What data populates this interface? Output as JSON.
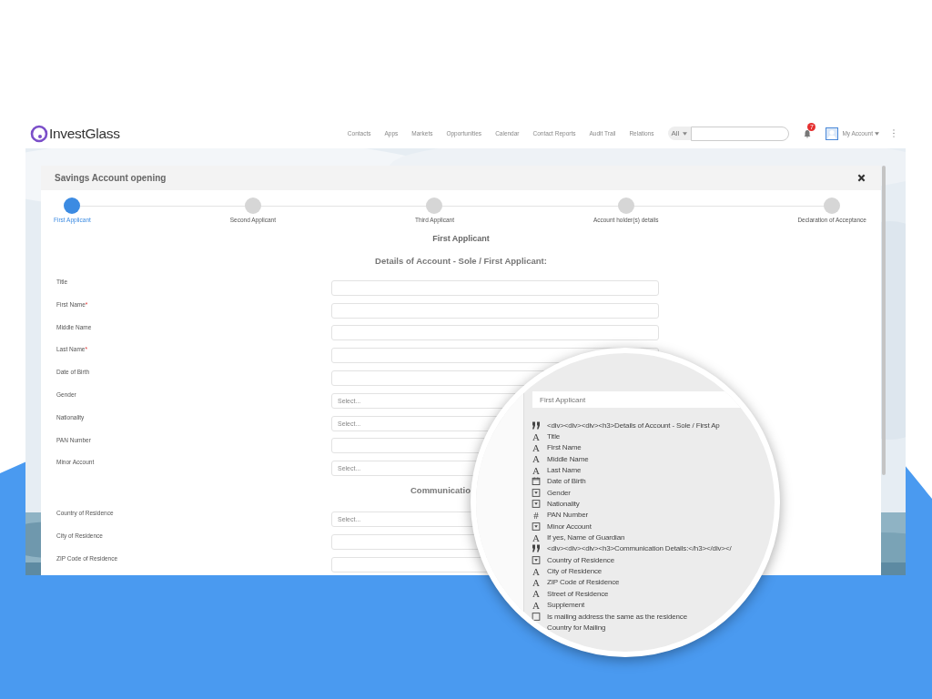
{
  "brand": {
    "name": "InvestGlass"
  },
  "nav": {
    "links": [
      "Contacts",
      "Apps",
      "Markets",
      "Opportunities",
      "Calendar",
      "Contact Reports",
      "Audit Trail",
      "Relations"
    ],
    "scope": "All",
    "notifications": "7",
    "account": "My Account"
  },
  "modal": {
    "title": "Savings Account opening",
    "steps": [
      {
        "label": "First Applicant",
        "selected": true
      },
      {
        "label": "Second Applicant",
        "selected": false
      },
      {
        "label": "Third Applicant",
        "selected": false
      },
      {
        "label": "Account holder(s) details",
        "selected": false
      },
      {
        "label": "Declaration of Acceptance",
        "selected": false
      }
    ],
    "heading": "First Applicant",
    "subheading": "Details of Account - Sole / First Applicant:",
    "rows": [
      {
        "label": "Title",
        "kind": "text"
      },
      {
        "label": "First Name",
        "required_mark": "*",
        "kind": "text"
      },
      {
        "label": "Middle Name",
        "kind": "text"
      },
      {
        "label": "Last Name",
        "required_mark": "*",
        "kind": "text"
      },
      {
        "label": "Date of Birth",
        "kind": "text"
      },
      {
        "label": "Gender",
        "kind": "select",
        "placeholder": "Select..."
      },
      {
        "label": "Nationality",
        "kind": "select",
        "placeholder": "Select..."
      },
      {
        "label": "PAN Number",
        "kind": "text"
      },
      {
        "label": "Minor Account",
        "kind": "select",
        "placeholder": "Select..."
      }
    ],
    "section": "Communicatio",
    "rows2": [
      {
        "label": "Country of Residence",
        "kind": "select",
        "placeholder": "Select..."
      },
      {
        "label": "City of Residence",
        "kind": "text"
      },
      {
        "label": "ZIP Code of Residence",
        "kind": "text"
      }
    ]
  },
  "magnifier": {
    "field": "First Applicant",
    "items": [
      {
        "kind": "html",
        "label": "<div><div><div><h3>Details of Account - Sole / First Ap"
      },
      {
        "kind": "text",
        "glyph": "A",
        "label": "Title"
      },
      {
        "kind": "text",
        "glyph": "A",
        "label": "First Name"
      },
      {
        "kind": "text",
        "glyph": "A",
        "label": "Middle Name"
      },
      {
        "kind": "text",
        "glyph": "A",
        "label": "Last Name"
      },
      {
        "kind": "date",
        "label": "Date of Birth"
      },
      {
        "kind": "select",
        "label": "Gender"
      },
      {
        "kind": "select",
        "label": "Nationality"
      },
      {
        "kind": "text",
        "glyph": "#",
        "label": "PAN Number"
      },
      {
        "kind": "select",
        "label": "Minor Account"
      },
      {
        "kind": "text",
        "glyph": "A",
        "label": "If yes, Name of Guardian"
      },
      {
        "kind": "html",
        "label": "<div><div><div><h3>Communication Details:</h3></div></"
      },
      {
        "kind": "select",
        "label": "Country of Residence"
      },
      {
        "kind": "text",
        "glyph": "A",
        "label": "City of Residence"
      },
      {
        "kind": "text",
        "glyph": "A",
        "label": "ZIP Code of Residence"
      },
      {
        "kind": "text",
        "glyph": "A",
        "label": "Street of Residence"
      },
      {
        "kind": "text",
        "glyph": "A",
        "label": "Supplement"
      },
      {
        "kind": "checkbox",
        "label": "Is mailing address the same as the residence"
      },
      {
        "kind": "plain",
        "label": "Country for Mailing"
      }
    ]
  }
}
